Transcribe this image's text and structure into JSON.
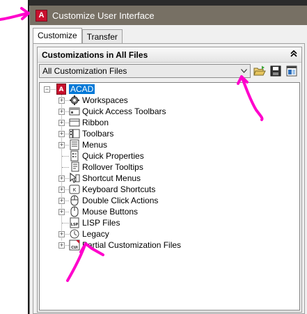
{
  "window": {
    "title": "Customize User Interface",
    "app_icon_letter": "A"
  },
  "tabs": [
    {
      "label": "Customize",
      "active": true
    },
    {
      "label": "Transfer",
      "active": false
    }
  ],
  "panel": {
    "header": "Customizations in All Files",
    "dropdown_value": "All Customization Files"
  },
  "tree": {
    "root": {
      "label": "ACAD"
    },
    "items": [
      {
        "label": "Workspaces",
        "icon": "workspaces-icon",
        "expandable": true
      },
      {
        "label": "Quick Access Toolbars",
        "icon": "quick-access-toolbars-icon",
        "expandable": true
      },
      {
        "label": "Ribbon",
        "icon": "ribbon-icon",
        "expandable": true
      },
      {
        "label": "Toolbars",
        "icon": "toolbars-icon",
        "expandable": true
      },
      {
        "label": "Menus",
        "icon": "menus-icon",
        "expandable": true
      },
      {
        "label": "Quick Properties",
        "icon": "quick-properties-icon",
        "expandable": false
      },
      {
        "label": "Rollover Tooltips",
        "icon": "rollover-tooltips-icon",
        "expandable": false
      },
      {
        "label": "Shortcut Menus",
        "icon": "shortcut-menus-icon",
        "expandable": true
      },
      {
        "label": "Keyboard Shortcuts",
        "icon": "keyboard-shortcuts-icon",
        "expandable": true
      },
      {
        "label": "Double Click Actions",
        "icon": "double-click-actions-icon",
        "expandable": true
      },
      {
        "label": "Mouse Buttons",
        "icon": "mouse-buttons-icon",
        "expandable": true
      },
      {
        "label": "LISP Files",
        "icon": "lisp-files-icon",
        "expandable": false
      },
      {
        "label": "Legacy",
        "icon": "legacy-icon",
        "expandable": true
      },
      {
        "label": "Partial Customization Files",
        "icon": "partial-customization-files-icon",
        "expandable": true
      }
    ]
  },
  "colors": {
    "titlebar": "#777064",
    "selection": "#0078d7",
    "annotation": "#ff00cc",
    "brand": "#c8102e"
  }
}
